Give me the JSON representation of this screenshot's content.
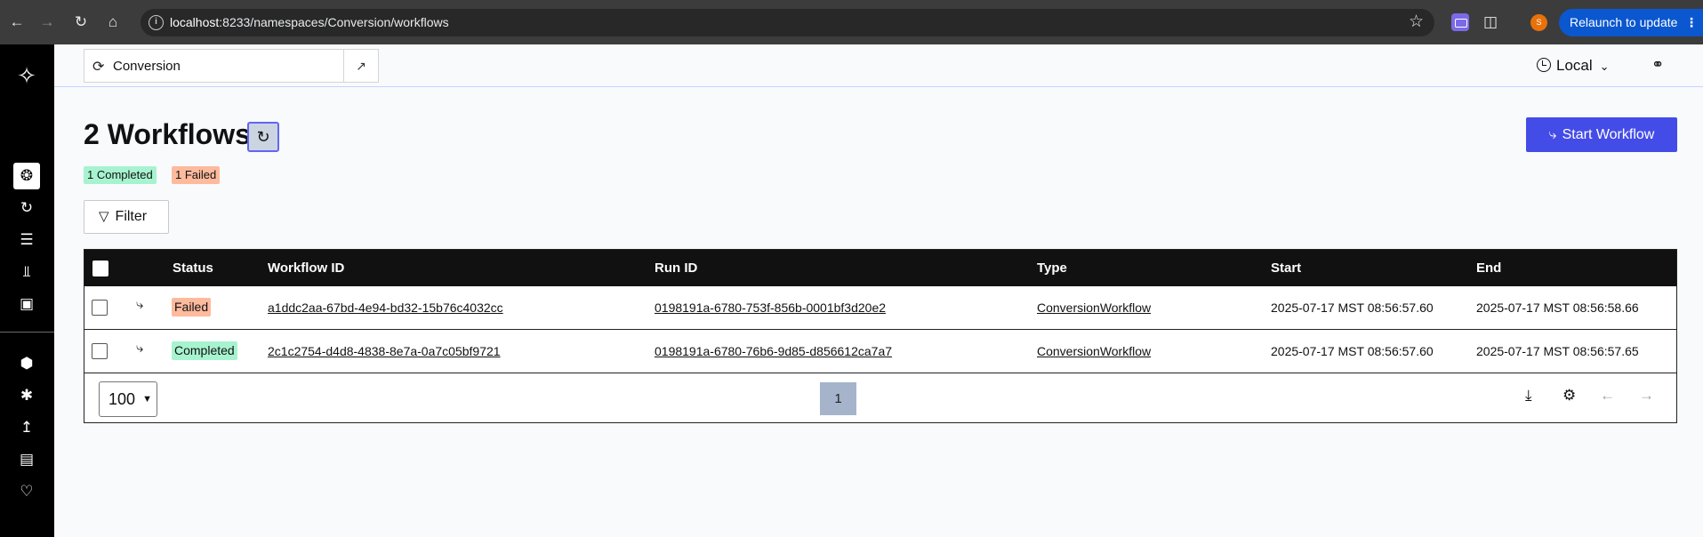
{
  "browser": {
    "url_host": "localhost",
    "url_path": ":8233/namespaces/Conversion/workflows",
    "profile_initial": "S",
    "relaunch_label": "Relaunch to update"
  },
  "appbar": {
    "namespace": "Conversion",
    "timezone": "Local"
  },
  "page": {
    "title": "2 Workflows",
    "completed_badge": "1 Completed",
    "failed_badge": "1 Failed",
    "filter_label": "Filter",
    "start_button": "Start Workflow"
  },
  "table": {
    "headers": {
      "status": "Status",
      "workflow_id": "Workflow ID",
      "run_id": "Run ID",
      "type": "Type",
      "start": "Start",
      "end": "End"
    },
    "rows": [
      {
        "status": "Failed",
        "workflow_id": "a1ddc2aa-67bd-4e94-bd32-15b76c4032cc",
        "run_id": "0198191a-6780-753f-856b-0001bf3d20e2",
        "type": "ConversionWorkflow",
        "start": "2025-07-17 MST 08:56:57.60",
        "end": "2025-07-17 MST 08:56:58.66"
      },
      {
        "status": "Completed",
        "workflow_id": "2c1c2754-d4d8-4838-8e7a-0a7c05bf9721",
        "run_id": "0198191a-6780-76b6-9d85-d856612ca7a7",
        "type": "ConversionWorkflow",
        "start": "2025-07-17 MST 08:56:57.60",
        "end": "2025-07-17 MST 08:56:57.65"
      }
    ],
    "page_size": "100",
    "current_page": "1"
  },
  "colors": {
    "sidebar": "#000000",
    "primary_button": "#444ce7",
    "completed": "#a7f3d0",
    "failed": "#fdba9d"
  }
}
